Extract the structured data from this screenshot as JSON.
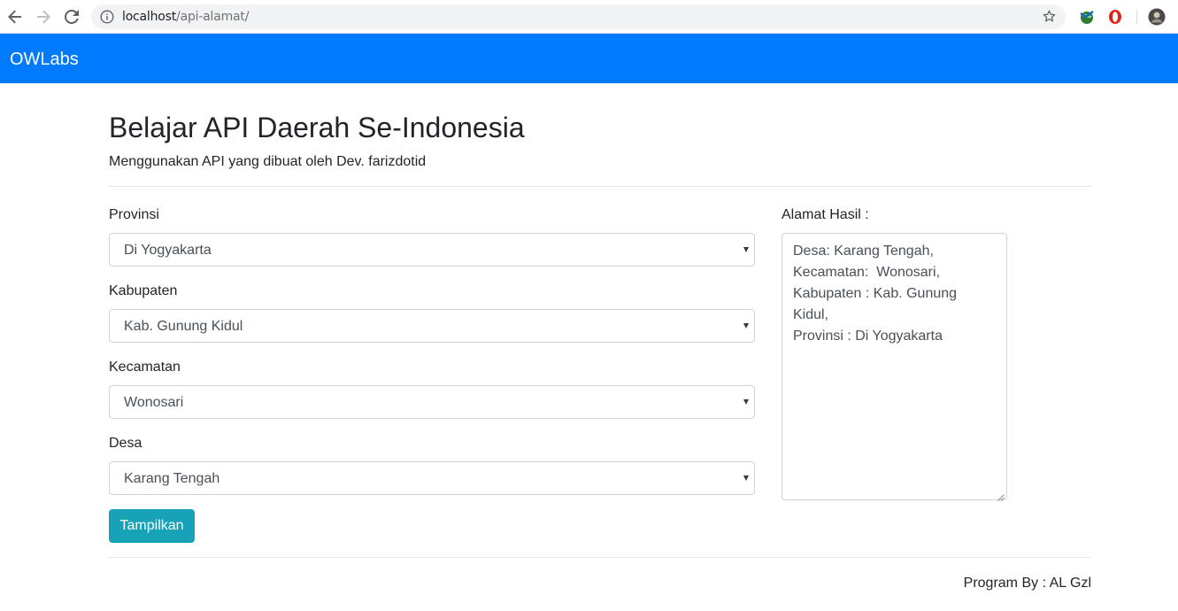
{
  "browser": {
    "url_host": "localhost",
    "url_path": "/api-alamat/",
    "icons": [
      "back-arrow-icon",
      "forward-arrow-icon",
      "reload-icon",
      "info-icon",
      "bookmark-star-icon",
      "extension-globe-icon",
      "opera-icon",
      "profile-avatar-icon"
    ]
  },
  "navbar": {
    "brand": "OWLabs",
    "color": "#007bff"
  },
  "header": {
    "title": "Belajar API Daerah Se-Indonesia",
    "subtitle": "Menggunakan API yang dibuat oleh Dev. farizdotid"
  },
  "form": {
    "provinsi": {
      "label": "Provinsi",
      "value": "Di Yogyakarta"
    },
    "kabupaten": {
      "label": "Kabupaten",
      "value": "Kab. Gunung Kidul"
    },
    "kecamatan": {
      "label": "Kecamatan",
      "value": "Wonosari"
    },
    "desa": {
      "label": "Desa",
      "value": "Karang Tengah"
    },
    "submit_label": "Tampilkan",
    "submit_color": "#17a2b8"
  },
  "result": {
    "label": "Alamat Hasil :",
    "text": "Desa: Karang Tengah,\nKecamatan:  Wonosari,\nKabupaten : Kab. Gunung Kidul,\nProvinsi : Di Yogyakarta"
  },
  "footer": {
    "credit": "Program By : AL Gzl"
  }
}
